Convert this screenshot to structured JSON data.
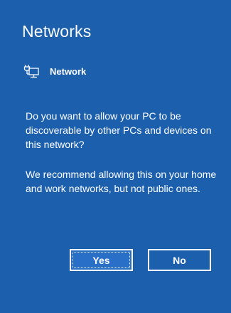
{
  "panel": {
    "title": "Networks",
    "network": {
      "icon": "network-icon",
      "name": "Network"
    },
    "message_1": "Do you want to allow your PC to be discoverable by other PCs and devices on this network?",
    "message_2": "We recommend allowing this on your home and work networks, but not public ones.",
    "buttons": {
      "yes_label": "Yes",
      "no_label": "No"
    }
  },
  "colors": {
    "background": "#1b5fad",
    "text": "#ffffff",
    "focused_button": "#2a6fc7"
  }
}
